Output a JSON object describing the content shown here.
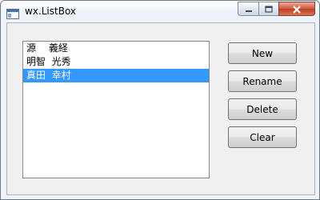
{
  "window": {
    "title": "wx.ListBox",
    "icon": "app-window-icon",
    "caption_buttons": [
      "minimize-icon",
      "maximize-icon",
      "close-icon"
    ]
  },
  "listbox": {
    "items": [
      "源　 義経",
      "明智  光秀",
      "真田  幸村"
    ],
    "selected_index": 2
  },
  "buttons": {
    "new": "New",
    "rename": "Rename",
    "delete": "Delete",
    "clear": "Clear"
  },
  "colors": {
    "selection": "#3399ff",
    "close_button": "#c8452a"
  }
}
